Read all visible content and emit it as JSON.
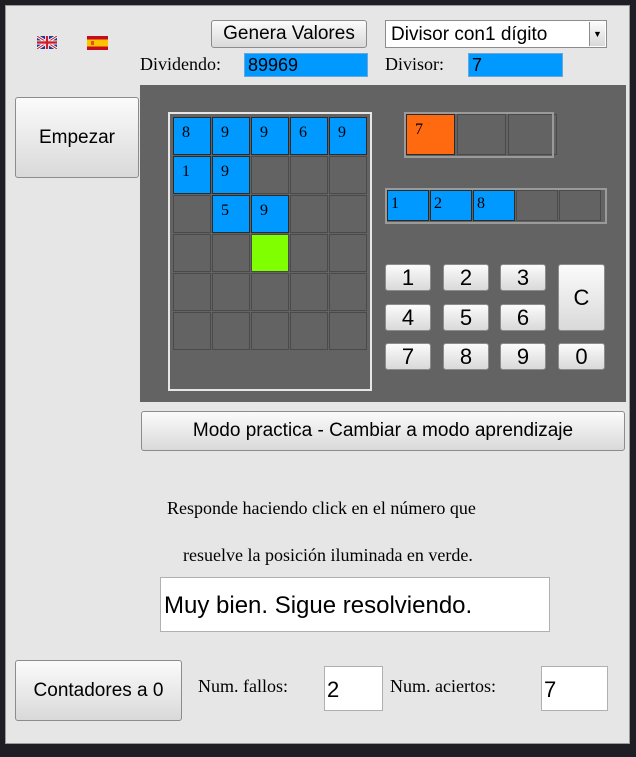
{
  "header": {
    "generate_label": "Genera Valores",
    "divisor_select": "Divisor con1 dígito",
    "dividend_label": "Dividendo:",
    "dividend_value": "89969",
    "divisor_label": "Divisor:",
    "divisor_value": "7"
  },
  "start_label": "Empezar",
  "division_grid": {
    "rows": [
      [
        "8",
        "9",
        "9",
        "6",
        "9"
      ],
      [
        "1",
        "9",
        "",
        "",
        ""
      ],
      [
        "",
        "5",
        "9",
        "",
        ""
      ],
      [
        "",
        "",
        "",
        "",
        ""
      ],
      [
        "",
        "",
        "",
        "",
        ""
      ],
      [
        "",
        "",
        "",
        "",
        ""
      ]
    ],
    "highlight_color": "#80ff00",
    "filled_color": "#0099ff"
  },
  "divisor_box": [
    "7",
    "",
    ""
  ],
  "quotient_row": [
    "1",
    "2",
    "8",
    "",
    ""
  ],
  "keypad": {
    "keys": [
      "1",
      "2",
      "3",
      "4",
      "5",
      "6",
      "7",
      "8",
      "9",
      "0"
    ],
    "clear": "C"
  },
  "mode_label": "Modo practica - Cambiar a modo aprendizaje",
  "instructions": {
    "line1": "Responde haciendo click en el número que",
    "line2": "resuelve la posición iluminada en verde."
  },
  "feedback": "Muy bien. Sigue resolviendo.",
  "counters": {
    "reset_label": "Contadores a 0",
    "fails_label": "Num. fallos:",
    "fails_value": "2",
    "hits_label": "Num. aciertos:",
    "hits_value": "7"
  },
  "flags": [
    "uk-flag-icon",
    "spain-flag-icon"
  ]
}
